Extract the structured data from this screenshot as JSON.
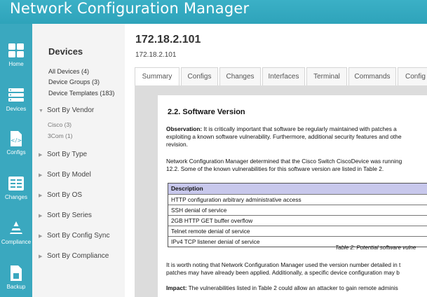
{
  "app": {
    "title": "Network Configuration Manager"
  },
  "rail": {
    "items": [
      {
        "label": "Home",
        "icon": "home-grid-icon"
      },
      {
        "label": "Devices",
        "icon": "devices-icon"
      },
      {
        "label": "Configs",
        "icon": "config-file-icon"
      },
      {
        "label": "Changes",
        "icon": "changes-icon"
      },
      {
        "label": "Compliance",
        "icon": "compliance-icon"
      },
      {
        "label": "Backup",
        "icon": "backup-icon"
      }
    ]
  },
  "devices": {
    "title": "Devices",
    "links": [
      {
        "label": "All Devices (4)"
      },
      {
        "label": "Device Groups (3)"
      },
      {
        "label": "Device Templates (183)"
      }
    ],
    "sorts": [
      {
        "label": "Sort By Vendor",
        "expanded": true,
        "children": [
          {
            "label": "Cisco (3)"
          },
          {
            "label": "3Com (1)"
          }
        ]
      },
      {
        "label": "Sort By Type"
      },
      {
        "label": "Sort By Model"
      },
      {
        "label": "Sort By OS"
      },
      {
        "label": "Sort By Series"
      },
      {
        "label": "Sort By Config Sync"
      },
      {
        "label": "Sort By Compliance"
      }
    ]
  },
  "main": {
    "title": "172.18.2.101",
    "subtitle": "172.18.2.101",
    "tabs": [
      {
        "label": "Summary"
      },
      {
        "label": "Configs"
      },
      {
        "label": "Changes"
      },
      {
        "label": "Interfaces"
      },
      {
        "label": "Terminal"
      },
      {
        "label": "Commands"
      },
      {
        "label": "Config"
      }
    ]
  },
  "report": {
    "heading": "2.2.  Software Version",
    "obs_label": "Observation:",
    "obs_l1": " It is critically important that software be regularly maintained with patches a",
    "obs_l2": "exploiting a known software vulnerability. Furthermore, additional security features and othe",
    "obs_l3": "revision.",
    "p2_l1": "Network Configuration Manager determined that the Cisco Switch CiscoDevice was running",
    "p2_l2": "12.2.  Some of the known vulnerabilities for this software version are listed in Table 2.",
    "table_header": "Description",
    "table_rows": [
      "HTTP configuration arbitrary administrative access",
      "SSH denial of service",
      "2GB HTTP GET buffer overflow",
      "Telnet remote denial of service",
      "IPv4 TCP listener denial of service"
    ],
    "caption": "Table 2: Potential software vulne",
    "p3_l1": "It is worth noting that Network Configuration Manager used the version number detailed in t",
    "p3_l2": "patches may have already been applied. Additionally, a specific device configuration  may b",
    "impact_label": "Impact:",
    "impact_text": " The vulnerabilities  listed in Table 2 could allow an attacker to gain remote adminis"
  }
}
